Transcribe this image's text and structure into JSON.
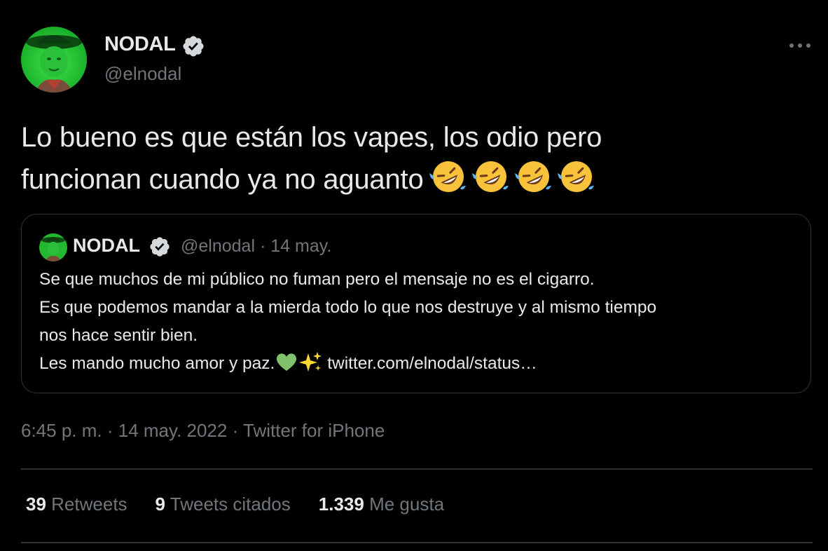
{
  "author": {
    "name": "NODAL",
    "handle": "@elnodal",
    "verified": true
  },
  "tweet": {
    "text": "Lo bueno es que están los vapes, los odio pero funcionan cuando ya no aguanto",
    "line1": "Lo bueno es que están los vapes, los odio pero",
    "line2": "funcionan cuando ya no aguanto",
    "emojis": [
      "rofl",
      "rofl",
      "rofl",
      "rofl"
    ]
  },
  "quote": {
    "name": "NODAL",
    "handle": "@elnodal",
    "meta": "@elnodal · 14 may.",
    "date": "14 may.",
    "lines": [
      "Se que muchos de mi público no fuman pero el mensaje no es el cigarro.",
      "Es que podemos mandar a la mierda todo lo que nos destruye y al mismo tiempo",
      "nos hace sentir bien.",
      "Les mando mucho amor y paz."
    ],
    "link": "twitter.com/elnodal/status…",
    "emojis": [
      "green-heart",
      "sparkles"
    ]
  },
  "meta": {
    "time": "6:45 p. m.",
    "date": "14 may. 2022",
    "source": "Twitter for iPhone",
    "full": "6:45 p. m. · 14 may. 2022 · Twitter for iPhone"
  },
  "stats": {
    "retweets_count": "39",
    "retweets_label": "Retweets",
    "quotes_count": "9",
    "quotes_label": "Tweets citados",
    "likes_count": "1.339",
    "likes_label": "Me gusta"
  },
  "icons": {
    "verified": "verified-badge-icon",
    "more": "more-options-icon"
  },
  "colors": {
    "background": "#000000",
    "text": "#e7e9ea",
    "secondary": "#71767b",
    "border": "#2f3336"
  }
}
